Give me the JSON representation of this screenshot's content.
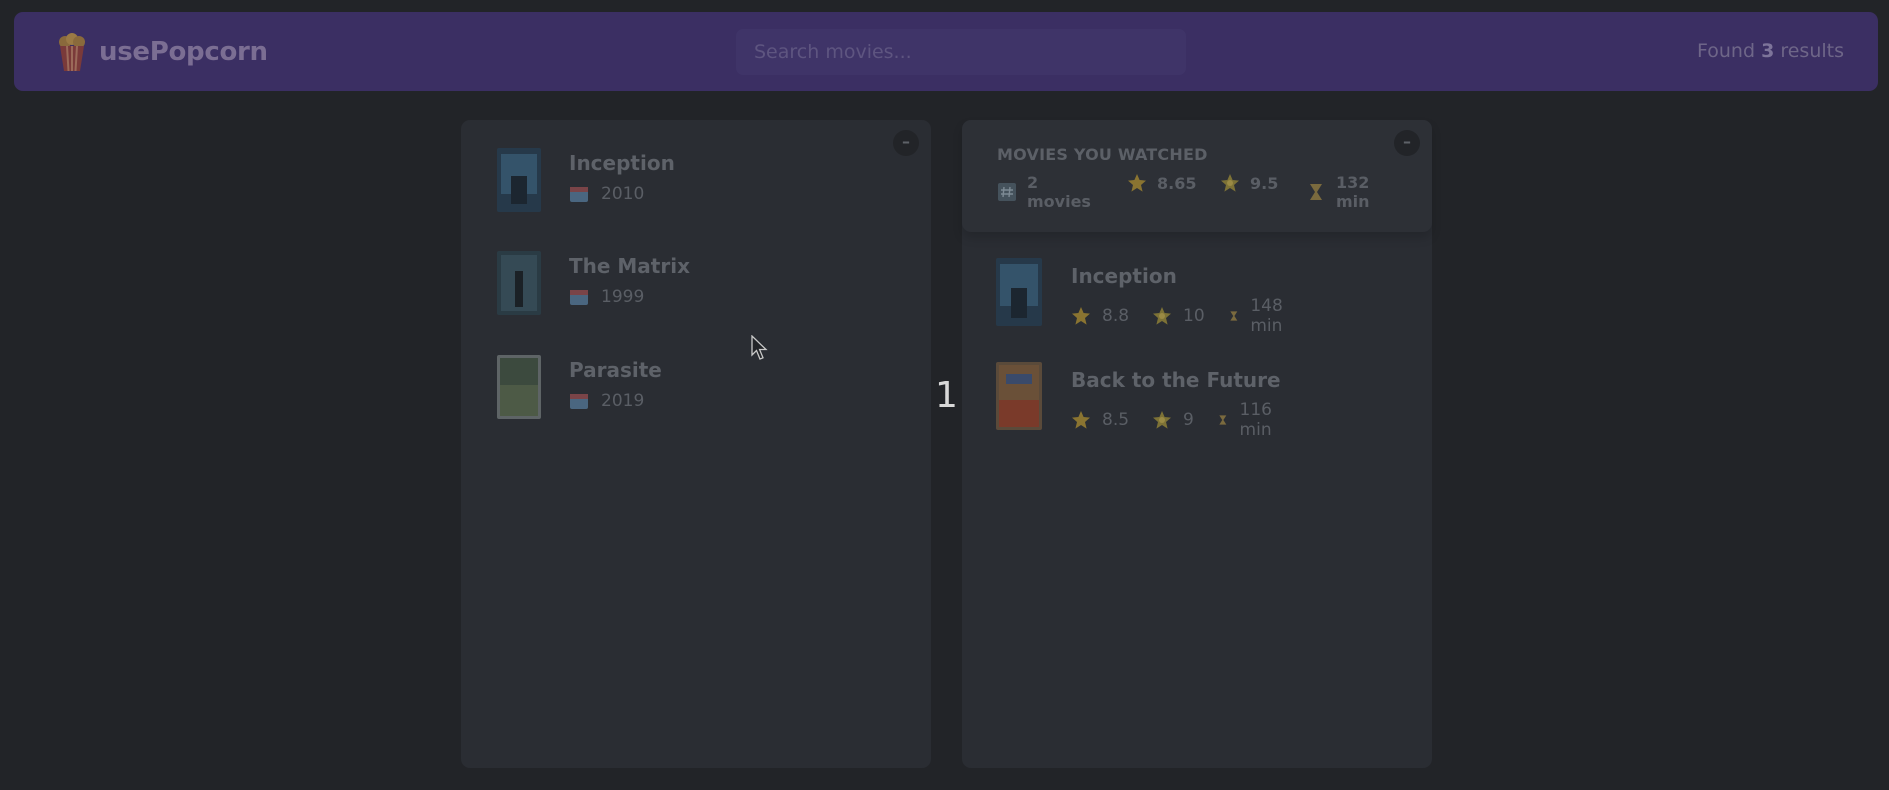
{
  "header": {
    "logo_text": "usePopcorn",
    "logo_icon": "popcorn-icon",
    "search_placeholder": "Search movies...",
    "results_prefix": "Found ",
    "results_count": "3",
    "results_suffix": " results"
  },
  "search_results": {
    "toggle_label": "–",
    "items": [
      {
        "title": "Inception",
        "year": "2010"
      },
      {
        "title": "The Matrix",
        "year": "1999"
      },
      {
        "title": "Parasite",
        "year": "2019"
      }
    ]
  },
  "watched": {
    "toggle_label": "–",
    "summary": {
      "heading": "MOVIES YOU WATCHED",
      "count_line1": "2",
      "count_line2": "movies",
      "avg_imdb": "8.65",
      "avg_user": "9.5",
      "runtime_line1": "132",
      "runtime_line2": "min"
    },
    "items": [
      {
        "title": "Inception",
        "imdb": "8.8",
        "user": "10",
        "runtime": "148 min"
      },
      {
        "title": "Back to the Future",
        "imdb": "8.5",
        "user": "9",
        "runtime": "116 min"
      }
    ]
  },
  "overlay_number": "1",
  "colors": {
    "navbar": "#3b2f63",
    "background": "#222428",
    "box": "#2a2d33",
    "star": "#8a7431"
  }
}
